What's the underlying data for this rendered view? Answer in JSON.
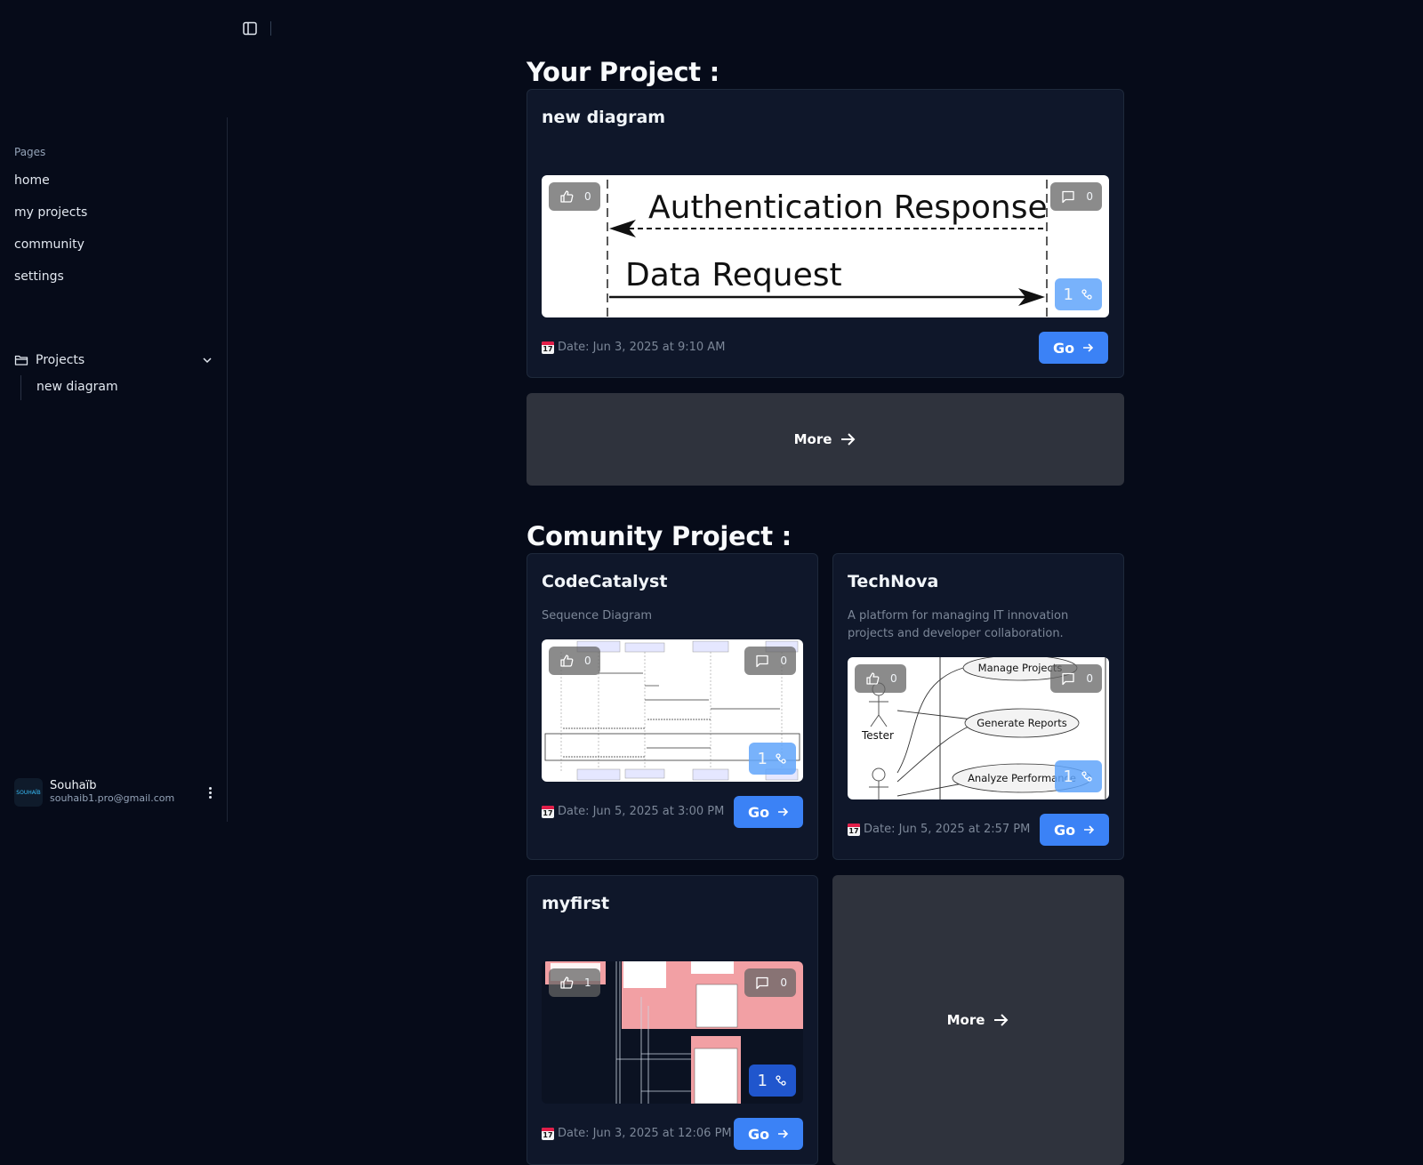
{
  "sidebar": {
    "pages_label": "Pages",
    "nav": [
      "home",
      "my projects",
      "community",
      "settings"
    ],
    "projects_label": "Projects",
    "projects": [
      "new diagram"
    ],
    "user": {
      "name": "Souhaïb",
      "email": "souhaib1.pro@gmail.com",
      "avatar_text": "SOUHAÏB"
    }
  },
  "your_projects": {
    "title": "Your Project :",
    "card": {
      "name": "new diagram",
      "likes": "0",
      "comments": "0",
      "forks": "1",
      "date": "Date: Jun 3, 2025 at 9:10 AM",
      "go": "Go",
      "preview": {
        "label_top": "Authentication Response",
        "label_bottom": "Data Request"
      }
    },
    "more": "More"
  },
  "community": {
    "title": "Comunity Project :",
    "cards": [
      {
        "name": "CodeCatalyst",
        "description": "Sequence Diagram",
        "likes": "0",
        "comments": "0",
        "forks": "1",
        "date": "Date: Jun 5, 2025 at 3:00 PM",
        "go": "Go"
      },
      {
        "name": "TechNova",
        "description": "A platform for managing IT innovation projects and developer collaboration.",
        "likes": "0",
        "comments": "0",
        "forks": "1",
        "date": "Date: Jun 5, 2025 at 2:57 PM",
        "go": "Go",
        "preview": {
          "actor": "Tester",
          "use_cases": [
            "Manage Projects",
            "Generate Reports",
            "Analyze Performance"
          ]
        }
      },
      {
        "name": "myfirst",
        "description": "",
        "likes": "1",
        "comments": "0",
        "forks": "1",
        "date": "Date: Jun 3, 2025 at 12:06 PM",
        "go": "Go"
      }
    ],
    "more": "More"
  },
  "icons": {
    "sidebar_toggle": "panel-left-icon",
    "like": "thumbs-up-icon",
    "comment": "message-square-icon",
    "fork": "git-fork-icon",
    "arrow": "arrow-right-icon",
    "calendar": "calendar-icon",
    "folder": "folder-icon",
    "chevron": "chevron-down-icon",
    "menu": "more-vertical-icon"
  },
  "calendar_day": "17",
  "colors": {
    "background": "#060b19",
    "card": "#0f172a",
    "accent": "#3b82f6",
    "more_bg": "#2f333d"
  }
}
